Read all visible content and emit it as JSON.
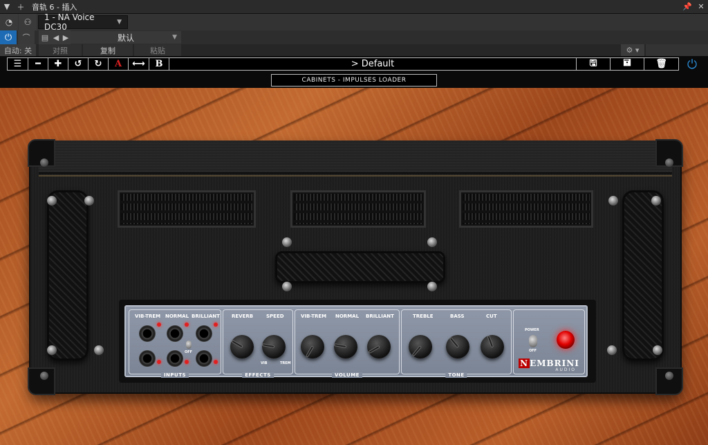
{
  "window": {
    "title": "音轨 6 - 插入"
  },
  "host": {
    "plugin_name": "1 - NA Voice DC30",
    "preset": "默认",
    "auto_label": "自动: 关",
    "compare_label": "对照",
    "copy_label": "复制",
    "paste_label": "粘贴"
  },
  "plugin": {
    "preset_title": "> Default",
    "cabinets_label": "CABINETS - IMPULSES LOADER",
    "toolbar": {
      "a_label": "A",
      "b_label": "B"
    },
    "panel": {
      "inputs": {
        "vib_trem": "VIB-TREM",
        "normal": "NORMAL",
        "brilliant": "BRILLIANT",
        "section": "INPUTS",
        "off": "OFF"
      },
      "effects": {
        "reverb": "REVERB",
        "speed": "SPEED",
        "vib": "VIB",
        "trem": "TREM",
        "section": "EFFECTS"
      },
      "volume": {
        "vib_trem": "VIB-TREM",
        "normal": "NORMAL",
        "brilliant": "BRILLIANT",
        "section": "VOLUME"
      },
      "tone": {
        "treble": "TREBLE",
        "bass": "BASS",
        "cut": "CUT",
        "section": "TONE"
      },
      "power": {
        "on": "POWER",
        "off": "OFF"
      },
      "logo": {
        "brand": "EMBRINI",
        "initial": "N",
        "sub": "AUDIO"
      }
    }
  },
  "colors": {
    "accent_blue": "#1d6bb5",
    "led_red": "#e02020"
  }
}
